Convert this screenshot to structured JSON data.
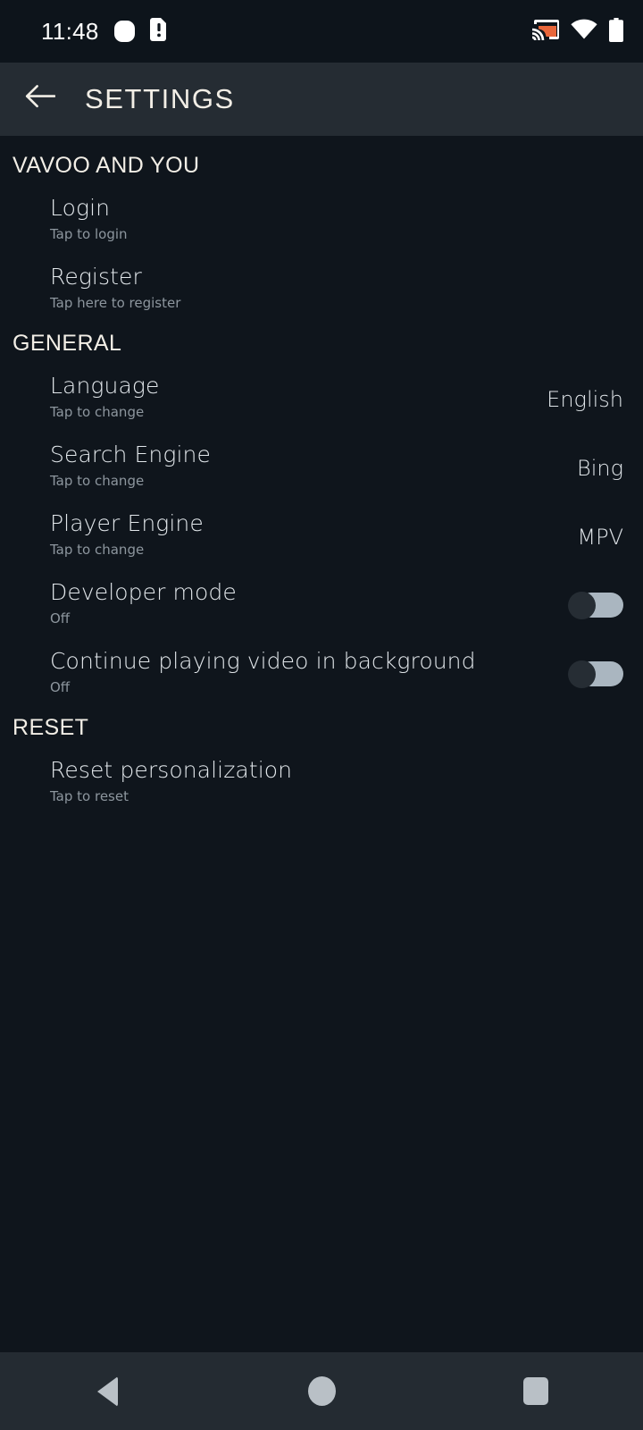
{
  "status_bar": {
    "time": "11:48",
    "icons": [
      "notification-dot-icon",
      "sim-card-alert-icon",
      "cast-icon",
      "wifi-icon",
      "battery-icon"
    ],
    "cast_accent_color": "#e8663a",
    "background_color": "#0d141b"
  },
  "app_bar": {
    "title": "SETTINGS",
    "back_icon": "arrow-back-icon",
    "background_color": "#252c33",
    "title_color": "#f2eee6"
  },
  "sections": [
    {
      "header": "VAVOO AND YOU",
      "items": [
        {
          "title": "Login",
          "subtitle": "Tap to login",
          "type": "link"
        },
        {
          "title": "Register",
          "subtitle": "Tap here to register",
          "type": "link"
        }
      ]
    },
    {
      "header": "GENERAL",
      "items": [
        {
          "title": "Language",
          "subtitle": "Tap to change",
          "type": "value",
          "value": "English"
        },
        {
          "title": "Search Engine",
          "subtitle": "Tap to change",
          "type": "value",
          "value": "Bing"
        },
        {
          "title": "Player Engine",
          "subtitle": "Tap to change",
          "type": "value",
          "value": "MPV"
        },
        {
          "title": "Developer mode",
          "subtitle": "Off",
          "type": "toggle",
          "value": "Off",
          "checked": false
        },
        {
          "title": "Continue playing video in background",
          "subtitle": "Off",
          "type": "toggle",
          "value": "Off",
          "checked": false
        }
      ]
    },
    {
      "header": "RESET",
      "items": [
        {
          "title": "Reset personalization",
          "subtitle": "Tap to reset",
          "type": "link"
        }
      ]
    }
  ],
  "nav_bar": {
    "buttons": [
      {
        "name": "back-nav-button",
        "icon": "triangle-back-icon"
      },
      {
        "name": "home-nav-button",
        "icon": "circle-home-icon"
      },
      {
        "name": "recents-nav-button",
        "icon": "square-recents-icon"
      }
    ],
    "background_color": "#242b32",
    "glyph_color": "#b9c0c6"
  },
  "theme": {
    "background_color": "#0f151c",
    "title_color": "#e2e7eb",
    "subtitle_color": "#8d969e",
    "toggle_track_color": "#aab6c0",
    "toggle_knob_color": "#262d34"
  }
}
